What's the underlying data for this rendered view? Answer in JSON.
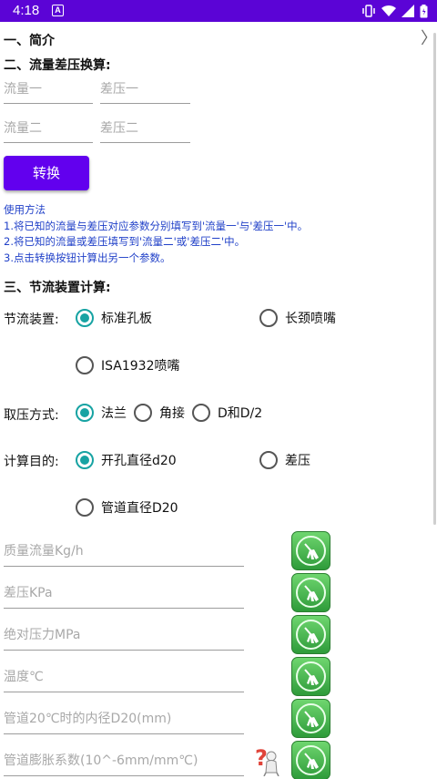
{
  "statusbar": {
    "time": "4:18",
    "app_icon_letter": "A"
  },
  "section1": {
    "title": "一、简介"
  },
  "section2": {
    "title": "二、流量差压换算:",
    "flow1_placeholder": "流量一",
    "dp1_placeholder": "差压一",
    "flow2_placeholder": "流量二",
    "dp2_placeholder": "差压二",
    "convert_label": "转换",
    "usage_lines": [
      "使用方法",
      "1.将已知的流量与差压对应参数分别填写到'流量一'与'差压一'中。",
      "2.将已知的流量或差压填写到'流量二'或'差压二'中。",
      "3.点击转换按钮计算出另一个参数。"
    ]
  },
  "section3": {
    "title": "三、节流装置计算:",
    "device": {
      "label": "节流装置:",
      "options": [
        "标准孔板",
        "长颈喷嘴",
        "ISA1932喷嘴"
      ],
      "selected": "标准孔板"
    },
    "tapping": {
      "label": "取压方式:",
      "options": [
        "法兰",
        "角接",
        "D和D/2"
      ],
      "selected": "法兰"
    },
    "target": {
      "label": "计算目的:",
      "options": [
        "开孔直径d20",
        "差压",
        "管道直径D20"
      ],
      "selected": "开孔直径d20"
    },
    "inputs": [
      "质量流量Kg/h",
      "差压KPa",
      "绝对压力MPa",
      "温度℃",
      "管道20℃时的内径D20(mm)",
      "管道膨胀系数(10^-6mm/mm℃)"
    ]
  },
  "colors": {
    "accent": "#6200ee",
    "statusbar": "#5b04d6",
    "radio_checked": "#17a3a3",
    "usage_text": "#2040c8",
    "clear_button": "#3fb24a"
  }
}
